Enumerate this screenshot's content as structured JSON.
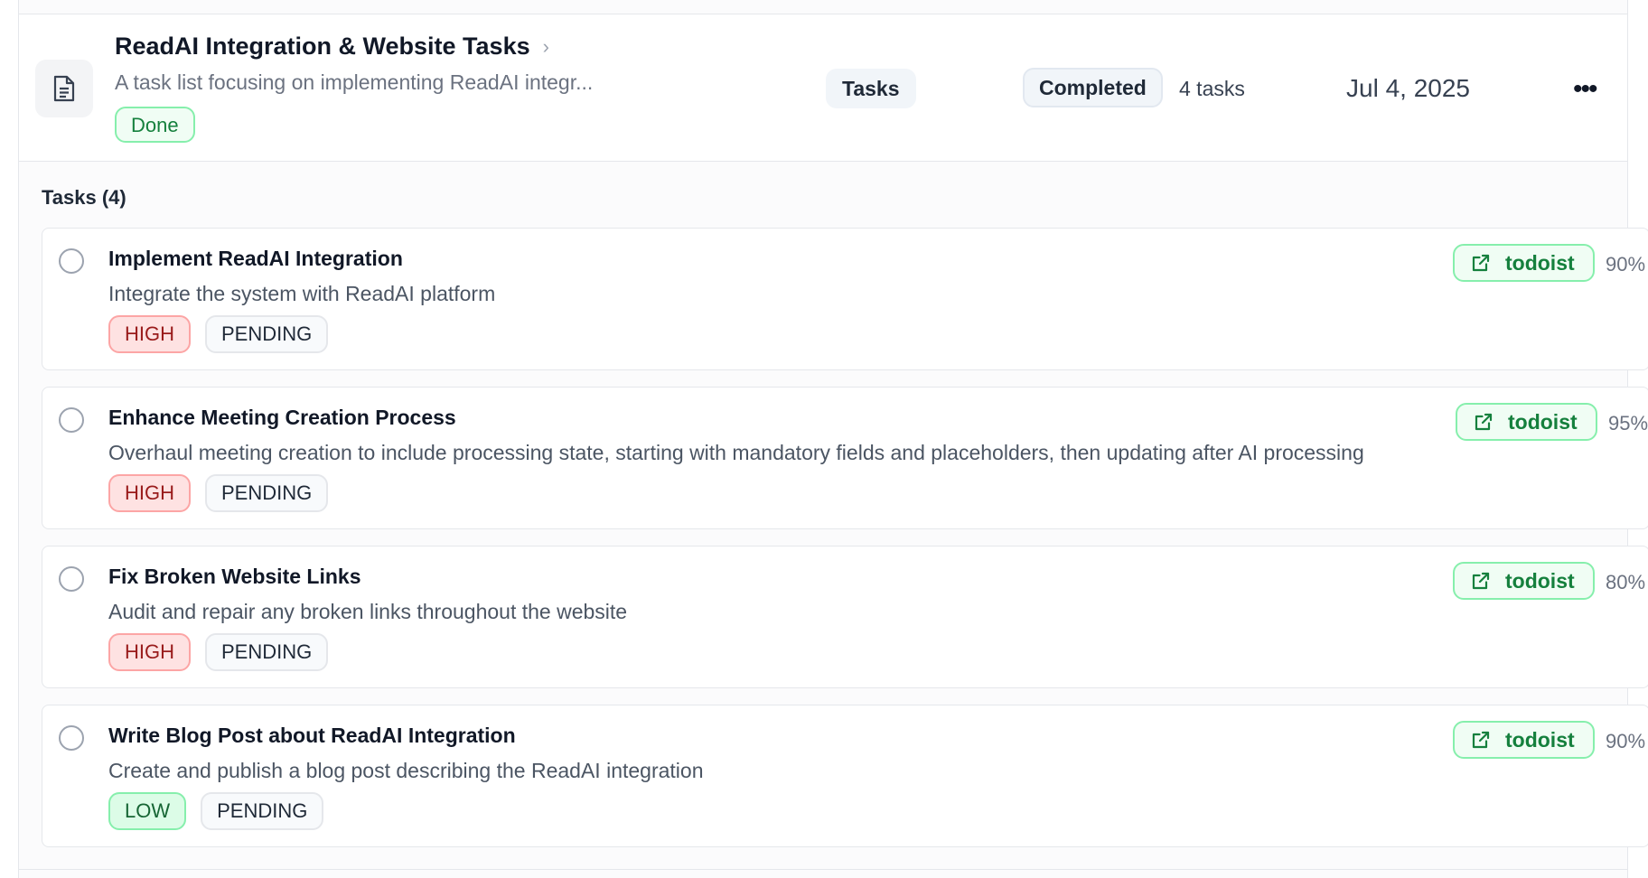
{
  "task_list": {
    "title": "ReadAI Integration & Website Tasks",
    "chevron": "›",
    "description": "A task list focusing on implementing ReadAI integr...",
    "done_label": "Done",
    "type": "Tasks",
    "status": "Completed",
    "task_count": "4 tasks",
    "date": "Jul 4, 2025",
    "more": "•••"
  },
  "tasks_section": {
    "heading": "Tasks (4)"
  },
  "tasks": [
    {
      "title": "Implement ReadAI Integration",
      "description": "Integrate the system with ReadAI platform",
      "priority": "HIGH",
      "status": "PENDING",
      "source": "todoist",
      "progress": "90%"
    },
    {
      "title": "Enhance Meeting Creation Process",
      "description": "Overhaul meeting creation to include processing state, starting with mandatory fields and placeholders, then updating after AI processing",
      "priority": "HIGH",
      "status": "PENDING",
      "source": "todoist",
      "progress": "95%"
    },
    {
      "title": "Fix Broken Website Links",
      "description": "Audit and repair any broken links throughout the website",
      "priority": "HIGH",
      "status": "PENDING",
      "source": "todoist",
      "progress": "80%"
    },
    {
      "title": "Write Blog Post about ReadAI Integration",
      "description": "Create and publish a blog post describing the ReadAI integration",
      "priority": "LOW",
      "status": "PENDING",
      "source": "todoist",
      "progress": "90%"
    }
  ],
  "icons": {
    "list_icon": "document-icon",
    "task_checkbox": "circle-checkbox-icon",
    "source_icon": "external-link-icon"
  },
  "colors": {
    "high": "#991b1b",
    "low": "#166534",
    "source": "#15803d"
  }
}
